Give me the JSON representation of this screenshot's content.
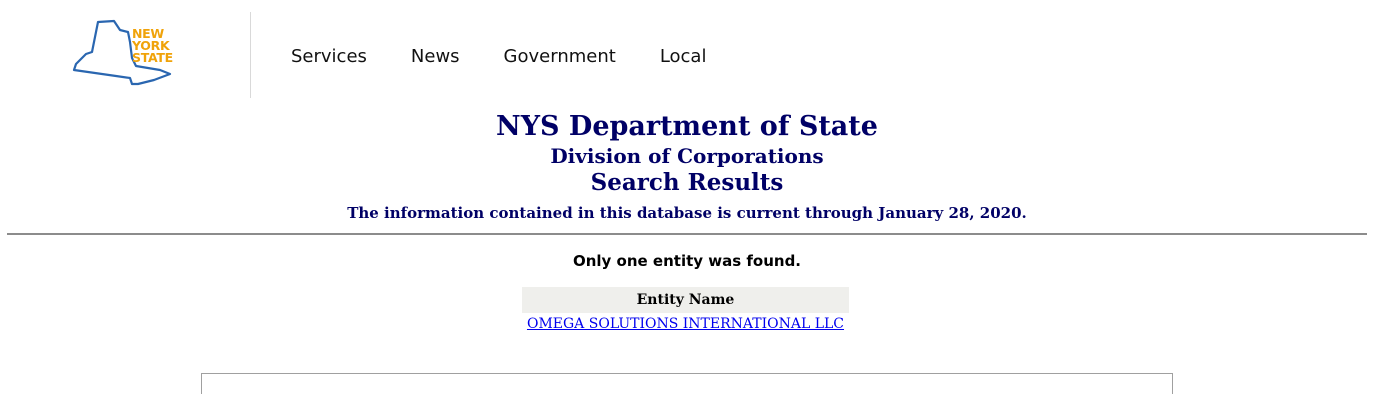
{
  "header": {
    "logo_lines": [
      "NEW",
      "YORK",
      "STATE"
    ],
    "nav": [
      {
        "label": "Services"
      },
      {
        "label": "News"
      },
      {
        "label": "Government"
      },
      {
        "label": "Local"
      }
    ]
  },
  "titles": {
    "department": "NYS Department of State",
    "division": "Division of Corporations",
    "page": "Search Results",
    "currency_note": "The information contained in this database is current through January 28, 2020."
  },
  "results": {
    "summary": "Only one entity was found.",
    "column_header": "Entity Name",
    "rows": [
      {
        "entity_name": "OMEGA SOLUTIONS INTERNATIONAL LLC"
      }
    ]
  },
  "colors": {
    "title_navy": "#000066",
    "logo_orange": "#f0a30a",
    "logo_blue": "#2a66b0",
    "link_blue": "#0000ee"
  }
}
